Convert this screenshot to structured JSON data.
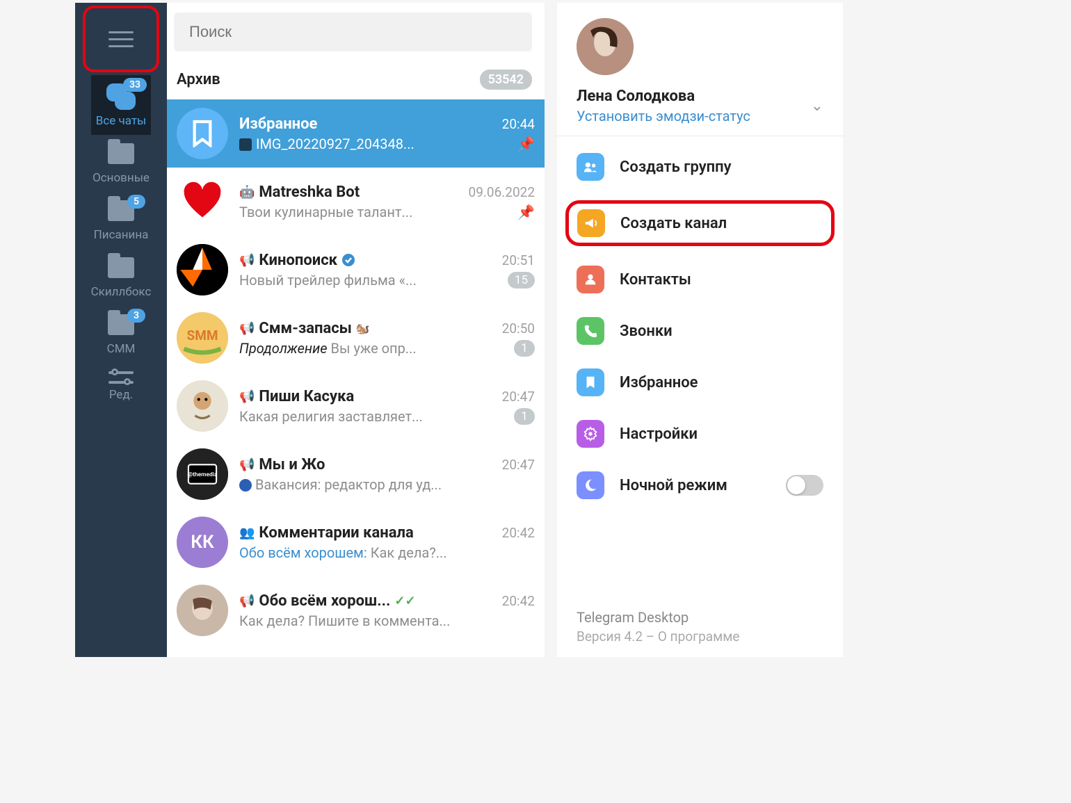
{
  "search": {
    "placeholder": "Поиск"
  },
  "tabs": [
    {
      "label": "Все чаты",
      "badge": "33",
      "kind": "all",
      "active": true
    },
    {
      "label": "Основные",
      "badge": null,
      "kind": "folder"
    },
    {
      "label": "Писанина",
      "badge": "5",
      "kind": "folder"
    },
    {
      "label": "Скиллбокс",
      "badge": null,
      "kind": "folder"
    },
    {
      "label": "СММ",
      "badge": "3",
      "kind": "folder"
    },
    {
      "label": "Ред.",
      "badge": null,
      "kind": "sliders"
    }
  ],
  "archive": {
    "label": "Архив",
    "count": "53542"
  },
  "chats": [
    {
      "name": "Избранное",
      "time": "20:44",
      "msg": "IMG_20220927_204348...",
      "pinned": true,
      "selected": true,
      "avatar": "bookmark",
      "type": null,
      "thumb": true
    },
    {
      "name": "Matreshka Bot",
      "time": "09.06.2022",
      "msg": "Твои кулинарные талант...",
      "pinned": true,
      "avatar": "heart",
      "type": "bot"
    },
    {
      "name": "Кинопоиск",
      "time": "20:51",
      "msg": "Новый трейлер фильма «...",
      "unread": "15",
      "avatar": "kino",
      "type": "channel",
      "verified": true
    },
    {
      "name": "Смм-запасы",
      "emoji": "🐿️",
      "time": "20:50",
      "msg_sender": "Продолжение",
      "msg": " Вы уже опр...",
      "unread": "1",
      "avatar": "smm",
      "type": "channel"
    },
    {
      "name": "Пиши Касука",
      "time": "20:47",
      "msg": "Какая религия заставляет...",
      "unread": "1",
      "avatar": "kasuka",
      "type": "channel"
    },
    {
      "name": "Мы и Жо",
      "time": "20:47",
      "msg_prefix_circle": true,
      "msg": " Вакансия: редактор для уд...",
      "avatar": "media",
      "type": "channel"
    },
    {
      "name": "Комментарии канала",
      "time": "20:42",
      "msg_blue": "Обо всём хорошем:",
      "msg": " Как дела?...",
      "avatar": "kk",
      "avatar_text": "КК",
      "type": "group"
    },
    {
      "name": "Обо всём хорош...",
      "time": "20:42",
      "msg": "Как дела? Пишите в коммента...",
      "avatar": "photo",
      "type": "channel",
      "checks": true
    }
  ],
  "profile": {
    "name": "Лена Солодкова",
    "status": "Установить эмодзи-статус"
  },
  "menu": [
    {
      "icon": "group",
      "color": "#56b3f5",
      "label": "Создать группу"
    },
    {
      "icon": "megaphone",
      "color": "#f5a623",
      "label": "Создать канал",
      "highlighted": true
    },
    {
      "icon": "person",
      "color": "#ee6f57",
      "label": "Контакты"
    },
    {
      "icon": "phone",
      "color": "#5dc466",
      "label": "Звонки"
    },
    {
      "icon": "bookmark",
      "color": "#56b3f5",
      "label": "Избранное"
    },
    {
      "icon": "gear",
      "color": "#b85ee6",
      "label": "Настройки"
    },
    {
      "icon": "moon",
      "color": "#7b8fff",
      "label": "Ночной режим",
      "toggle": true
    }
  ],
  "footer": {
    "app": "Telegram Desktop",
    "version": "Версия 4.2 – О программе"
  }
}
